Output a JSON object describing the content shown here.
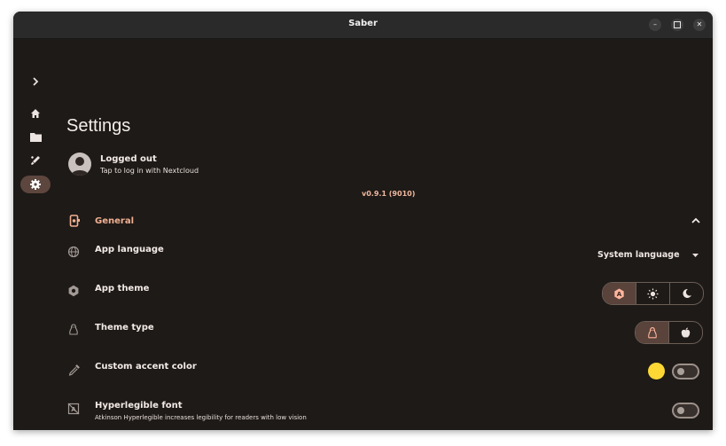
{
  "window": {
    "title": "Saber"
  },
  "colors": {
    "accent": "#f1b093",
    "background": "#1e1a17",
    "swatch": "#fdd835"
  },
  "rail": {
    "expand_icon": "chevron-right-icon",
    "items": [
      {
        "icon": "home-icon",
        "active": false
      },
      {
        "icon": "folder-icon",
        "active": false
      },
      {
        "icon": "brush-icon",
        "active": false
      },
      {
        "icon": "gear-icon",
        "active": true
      }
    ]
  },
  "page": {
    "title": "Settings"
  },
  "account": {
    "status": "Logged out",
    "hint": "Tap to log in with Nextcloud"
  },
  "version": "v0.9.1 (9010)",
  "general": {
    "label": "General",
    "expanded": true,
    "rows": {
      "app_language": {
        "title": "App language",
        "value": "System language"
      },
      "app_theme": {
        "title": "App theme",
        "selected": "system",
        "options": [
          "system",
          "light",
          "dark"
        ]
      },
      "theme_type": {
        "title": "Theme type",
        "selected": "linux",
        "options": [
          "linux",
          "apple"
        ]
      },
      "custom_accent": {
        "title": "Custom accent color",
        "color": "#fdd835",
        "enabled": false
      },
      "hyperlegible": {
        "title": "Hyperlegible font",
        "description": "Atkinson Hyperlegible increases legibility for readers with low vision",
        "enabled": false
      }
    }
  }
}
